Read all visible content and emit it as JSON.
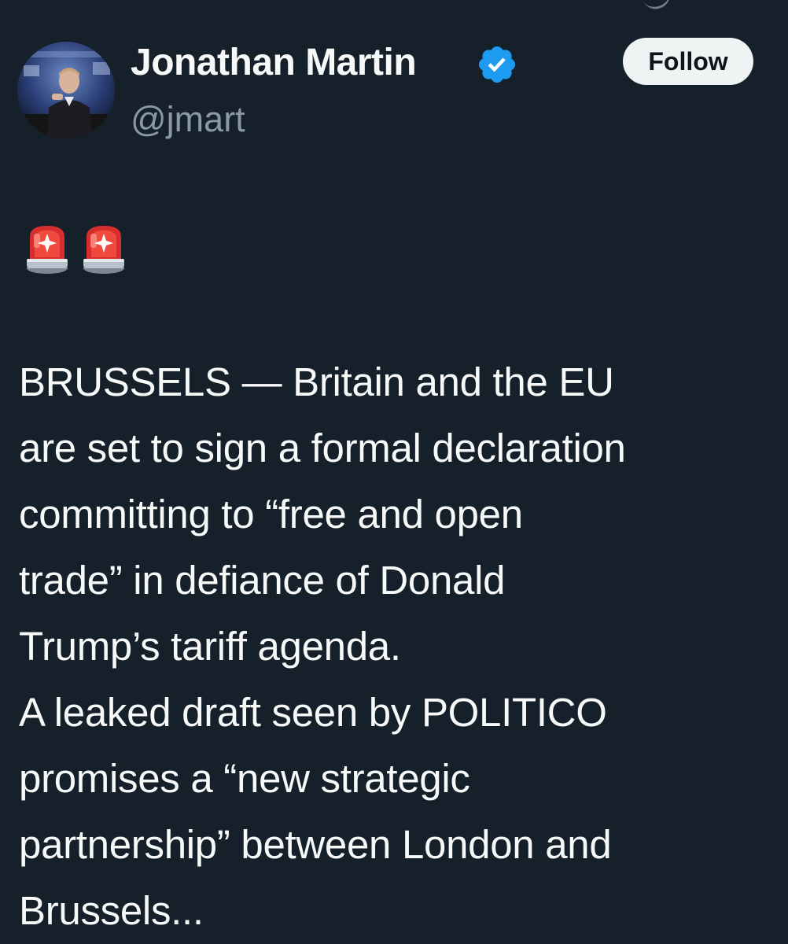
{
  "author": {
    "display_name": "Jonathan Martin",
    "handle": "@jmart",
    "verified": true,
    "verified_color": "#1d9bf0"
  },
  "follow_button": {
    "label": "Follow"
  },
  "icons": {
    "verified": "verified-badge-icon",
    "siren": "police-car-light-emoji"
  },
  "tweet": {
    "emoji_count": 2,
    "text": "BRUSSELS — Britain and the EU\nare set to sign a formal declaration\ncommitting to “free and open\ntrade” in defiance of Donald\nTrump’s tariff agenda.\nA leaked draft seen by POLITICO\npromises a “new strategic\npartnership” between London and\nBrussels..."
  },
  "colors": {
    "background": "#15202b",
    "text": "#f7f9f9",
    "secondary_text": "#8b98a5",
    "button_bg": "#eff3f4"
  }
}
